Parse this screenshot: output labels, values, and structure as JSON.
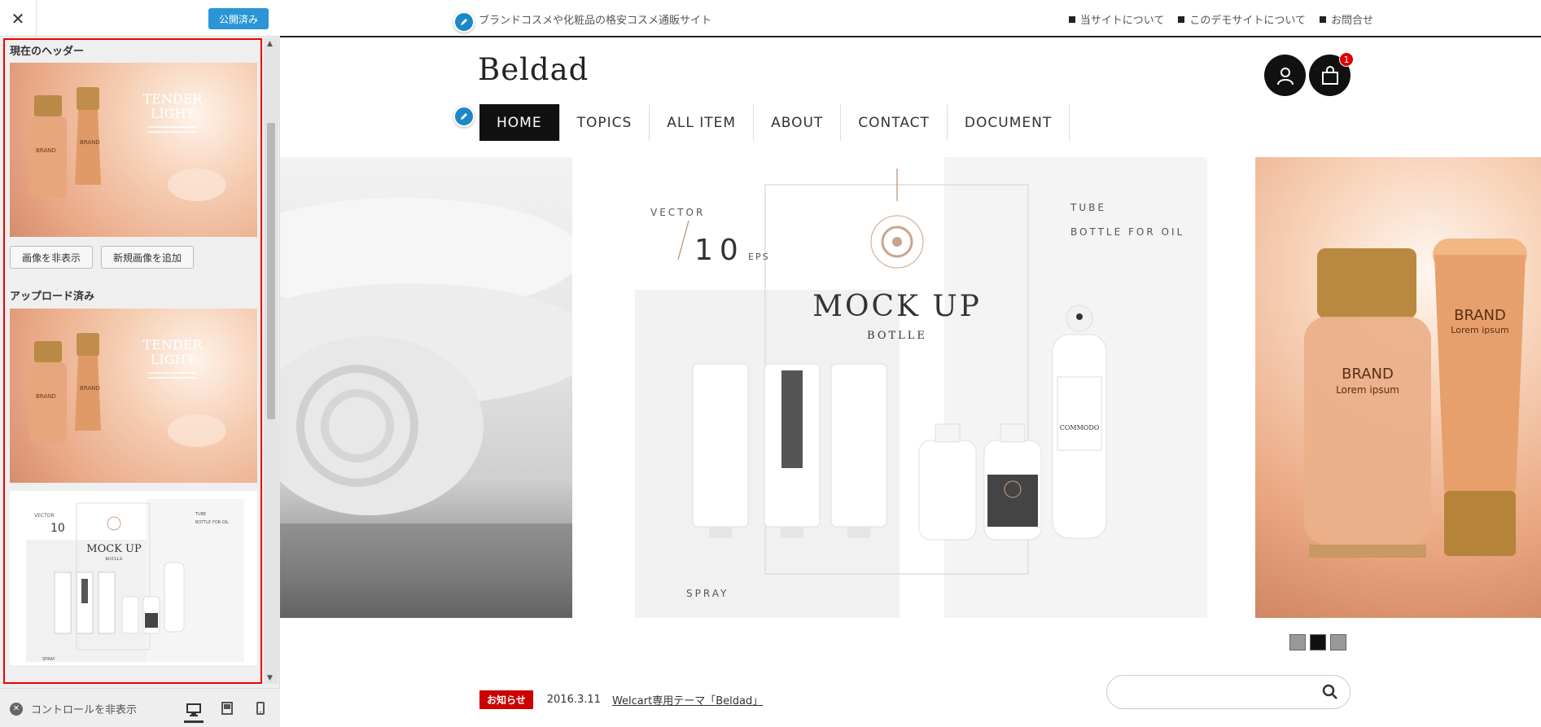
{
  "customizer": {
    "close_icon": "close-icon",
    "publish_label": "公開済み",
    "current_header_heading": "現在のヘッダー",
    "hide_image_label": "画像を非表示",
    "add_image_label": "新規画像を追加",
    "uploaded_heading": "アップロード済み",
    "hide_controls_label": "コントロールを非表示",
    "devices": [
      "desktop-icon",
      "tablet-icon",
      "mobile-icon"
    ],
    "accent": "#2a96d6",
    "panel_border": "#e00000"
  },
  "thumbs": {
    "cosmetic_title_1": "TENDER",
    "cosmetic_title_2": "LIGHT",
    "cosmetic_brand": "BRAND",
    "mock_vector": "VECTOR",
    "mock_num": "10",
    "mock_eps": "EPS",
    "mock_tube": "TUBE",
    "mock_bottle_oil": "BOTTLE FOR OIL",
    "mock_title": "MOCK UP",
    "mock_sub": "BOTLLE",
    "mock_spray": "SPRAY"
  },
  "site": {
    "tagline": "ブランドコスメや化粧品の格安コスメ通販サイト",
    "top_links": [
      "当サイトについて",
      "このデモサイトについて",
      "お問合せ"
    ],
    "logo": "Beldad",
    "cart_count": "1",
    "nav": [
      "HOME",
      "TOPICS",
      "ALL ITEM",
      "ABOUT",
      "CONTACT",
      "DOCUMENT"
    ],
    "nav_active": "HOME"
  },
  "slide_mockup": {
    "vector": "VECTOR",
    "number": "10",
    "eps": "EPS",
    "tube": "TUBE",
    "bottle_for_oil": "BOTTLE FOR OIL",
    "title": "MOCK UP",
    "subtitle": "BOTLLE",
    "spray": "SPRAY",
    "label_brand": "COMMODO"
  },
  "slide_cosmetic": {
    "brand_1": "BRAND",
    "lorem_1": "Lorem ipsum",
    "brand_2": "BRAND",
    "lorem_2": "Lorem ipsum"
  },
  "pager": {
    "count": 3,
    "active_index": 1
  },
  "news": {
    "badge": "お知らせ",
    "date": "2016.3.11",
    "link": "Welcart専用テーマ「Beldad」"
  },
  "search": {
    "placeholder": "",
    "icon": "search-icon"
  }
}
